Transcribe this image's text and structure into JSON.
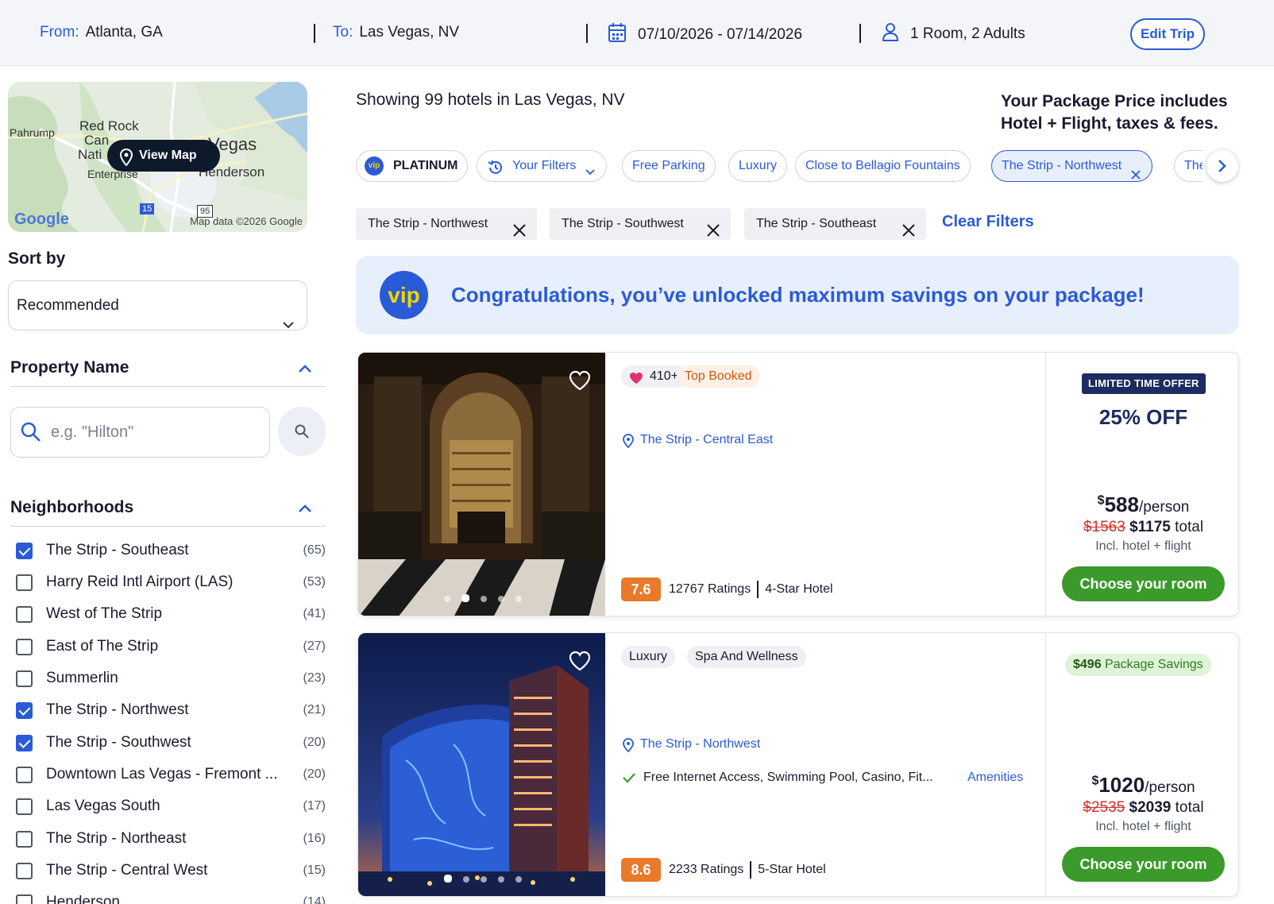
{
  "trip": {
    "from_label": "From:",
    "from_value": "Atlanta, GA",
    "to_label": "To:",
    "to_value": "Las Vegas, NV",
    "dates": "07/10/2026 - 07/14/2026",
    "guests": "1 Room, 2 Adults",
    "edit_label": "Edit Trip"
  },
  "map": {
    "view_map_label": "View Map",
    "places": [
      "Pahrump",
      "Red Rock",
      "Can",
      "Nati",
      "Vegas",
      "Enterprise",
      "Henderson",
      "15",
      "95"
    ],
    "logo": "Google",
    "credit": "Map data ©2026 Google"
  },
  "sort": {
    "title": "Sort by",
    "selected": "Recommended"
  },
  "property_name": {
    "title": "Property Name",
    "placeholder": "e.g. \"Hilton\""
  },
  "neighborhoods": {
    "title": "Neighborhoods",
    "items": [
      {
        "label": "The Strip - Southeast",
        "count": "(65)",
        "checked": true
      },
      {
        "label": "Harry Reid Intl Airport (LAS)",
        "count": "(53)",
        "checked": false
      },
      {
        "label": "West of The Strip",
        "count": "(41)",
        "checked": false
      },
      {
        "label": "East of The Strip",
        "count": "(27)",
        "checked": false
      },
      {
        "label": "Summerlin",
        "count": "(23)",
        "checked": false
      },
      {
        "label": "The Strip - Northwest",
        "count": "(21)",
        "checked": true
      },
      {
        "label": "The Strip - Southwest",
        "count": "(20)",
        "checked": true
      },
      {
        "label": "Downtown Las Vegas - Fremont ...",
        "count": "(20)",
        "checked": false
      },
      {
        "label": "Las Vegas South",
        "count": "(17)",
        "checked": false
      },
      {
        "label": "The Strip - Northeast",
        "count": "(16)",
        "checked": false
      },
      {
        "label": "The Strip - Central West",
        "count": "(15)",
        "checked": false
      },
      {
        "label": "Henderson",
        "count": "(14)",
        "checked": false
      }
    ]
  },
  "results": {
    "showing": "Showing 99 hotels in Las Vegas, NV",
    "package_note_1": "Your Package Price includes",
    "package_note_2": "Hotel + Flight, taxes & fees."
  },
  "chips": {
    "platinum": "PLATINUM",
    "vip_mark": "vip",
    "your_filters": "Your Filters",
    "free_parking": "Free Parking",
    "luxury": "Luxury",
    "bellagio": "Close to Bellagio Fountains",
    "strip_nw": "The Strip - Northwest",
    "overflow": "The"
  },
  "applied_filters": {
    "tags": [
      "The Strip - Northwest",
      "The Strip - Southwest",
      "The Strip - Southeast"
    ],
    "clear_label": "Clear Filters"
  },
  "vip_banner": {
    "mark": "vip",
    "message": "Congratulations, you’ve unlocked maximum savings on your package!"
  },
  "hotels": [
    {
      "likes": "410+",
      "tag": "Top Booked",
      "location": "The Strip - Central East",
      "score": "7.6",
      "ratings": "12767 Ratings",
      "stars": "4-Star Hotel",
      "offer_label": "LIMITED TIME OFFER",
      "offer": "25% OFF",
      "price_currency": "$",
      "price_amount": "588",
      "per_person": "/person",
      "old_total": "$1563",
      "new_total": "$1175",
      "total_word": "total",
      "incl": "Incl. hotel + flight",
      "cta": "Choose your room"
    },
    {
      "tag_1": "Luxury",
      "tag_2": "Spa And Wellness",
      "location": "The Strip - Northwest",
      "amenities": "Free Internet Access, Swimming Pool, Casino, Fit...",
      "amenities_link": "Amenities",
      "score": "8.6",
      "ratings": "2233 Ratings",
      "stars": "5-Star Hotel",
      "savings_amount": "$496",
      "savings_label": "Package Savings",
      "price_currency": "$",
      "price_amount": "1020",
      "per_person": "/person",
      "old_total": "$2535",
      "new_total": "$2039",
      "total_word": "total",
      "incl": "Incl. hotel + flight",
      "cta": "Choose your room"
    }
  ],
  "colors": {
    "brand_blue": "#2a5bd7",
    "vip_yellow": "#f5d400",
    "cta_green": "#3a9a2a",
    "score_orange": "#e87a2a",
    "strike_red": "#d0302a"
  }
}
